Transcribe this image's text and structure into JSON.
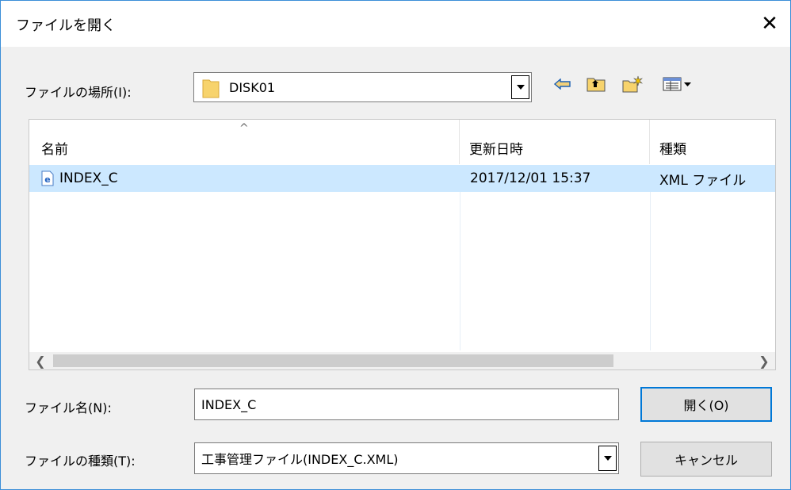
{
  "dialog": {
    "title": "ファイルを開く"
  },
  "location": {
    "label": "ファイルの場所(I):",
    "value": "DISK01"
  },
  "list": {
    "columns": [
      "名前",
      "更新日時",
      "種類"
    ],
    "rows": [
      {
        "name": "INDEX_C",
        "modified": "2017/12/01 15:37",
        "type": "XML ファイル"
      }
    ]
  },
  "filename": {
    "label": "ファイル名(N):",
    "value": "INDEX_C"
  },
  "filetype": {
    "label": "ファイルの種類(T):",
    "value": "工事管理ファイル(INDEX_C.XML)"
  },
  "buttons": {
    "open": "開く(O)",
    "cancel": "キャンセル"
  },
  "colors": {
    "selection": "#cce8ff",
    "accent": "#0078d7",
    "folder": "#f7d36c"
  }
}
